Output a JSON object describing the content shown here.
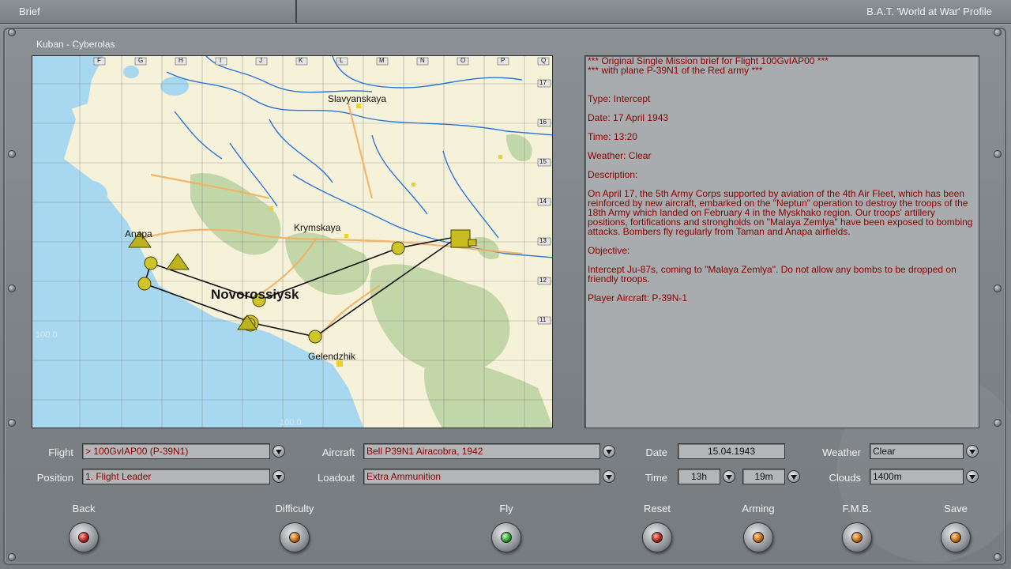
{
  "topbar": {
    "left_title": "Brief",
    "right_title": "B.A.T. 'World at War' Profile"
  },
  "map": {
    "title": "Kuban - Cyberolas",
    "columns": [
      "F",
      "G",
      "H",
      "I",
      "J",
      "K",
      "L",
      "M",
      "N",
      "O",
      "P",
      "Q"
    ],
    "rows": [
      "17",
      "16",
      "15",
      "14",
      "13",
      "12",
      "11"
    ],
    "places": {
      "slavyanskaya": "Slavyanskaya",
      "krymskaya": "Krymskaya",
      "anapa": "Anapa",
      "novorossiysk": "Novorossiysk",
      "gelendzhik": "Gelendzhik"
    },
    "scale_left": "100.0",
    "scale_bottom": "100.0"
  },
  "brief": {
    "header1": "*** Original Single Mission brief for Flight 100GvIAP00 ***",
    "header2": "*** with plane P-39N1 of the Red army ***",
    "type": "Type: Intercept",
    "date": "Date: 17 April 1943",
    "time": "Time: 13:20",
    "weather": "Weather: Clear",
    "description_title": "Description:",
    "description": "On April 17, the 5th Army Corps supported by aviation of the 4th Air Fleet, which has been reinforced by new aircraft, embarked on the \"Neptun\" operation to destroy the troops of the 18th Army which landed on February 4 in the Myskhako region. Our troops' artillery positions, fortifications and strongholds on \"Malaya Zemlya\" have been exposed to bombing attacks. Bombers fly regularly from Taman and Anapa airfields.",
    "objective_title": "Objective:",
    "objective": "Intercept Ju-87s, coming to \"Malaya Zemlya\". Do not allow any bombs to be dropped on friendly troops.",
    "player_aircraft": "Player Aircraft: P-39N-1"
  },
  "form": {
    "flight_label": "Flight",
    "flight_value": "> 100GvIAP00 (P-39N1)",
    "position_label": "Position",
    "position_value": "1. Flight Leader",
    "aircraft_label": "Aircraft",
    "aircraft_value": "Bell P39N1 Airacobra, 1942",
    "loadout_label": "Loadout",
    "loadout_value": "Extra Ammunition",
    "date_label": "Date",
    "date_value": "15.04.1943",
    "time_label": "Time",
    "time_hour": "13h",
    "time_min": "19m",
    "weather_label": "Weather",
    "weather_value": "Clear",
    "clouds_label": "Clouds",
    "clouds_value": "1400m"
  },
  "buttons": {
    "back": "Back",
    "difficulty": "Difficulty",
    "fly": "Fly",
    "reset": "Reset",
    "arming": "Arming",
    "fmb": "F.M.B.",
    "save": "Save"
  },
  "colors": {
    "brief_text": "#8c0000",
    "sea": "#a8d8f0",
    "land": "#f6f2da",
    "route": "#111111",
    "waypoint": "#c8c020"
  }
}
